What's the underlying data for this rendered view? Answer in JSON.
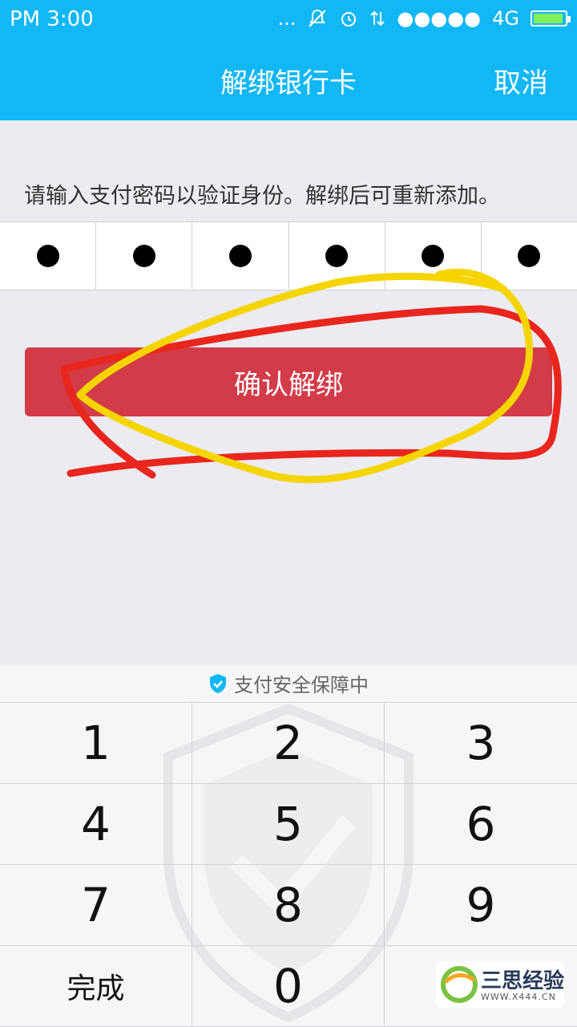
{
  "status_bar": {
    "time": "PM 3:00",
    "dots": "...",
    "signal": "●●●●●",
    "network": "4G"
  },
  "nav": {
    "title": "解绑银行卡",
    "cancel_label": "取消"
  },
  "hint_text": "请输入支付密码以验证身份。解绑后可重新添加。",
  "password": {
    "length": 6,
    "filled": 6
  },
  "confirm_label": "确认解绑",
  "keyboard": {
    "security_text": "支付安全保障中",
    "keys": [
      "1",
      "2",
      "3",
      "4",
      "5",
      "6",
      "7",
      "8",
      "9",
      "完成",
      "0",
      ""
    ]
  },
  "logo": {
    "name": "三思经验",
    "url_text": "WWW.X444.CN"
  },
  "colors": {
    "accent": "#12b7f5",
    "confirm": "#d33b48",
    "annotation_red": "#e8261e",
    "annotation_yellow": "#f5d400"
  }
}
